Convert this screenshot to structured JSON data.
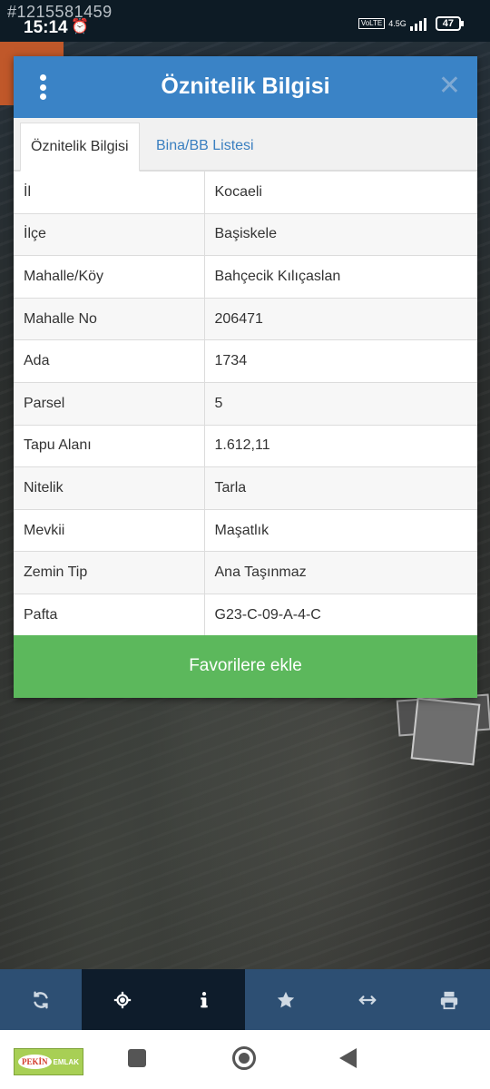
{
  "status_bar": {
    "watermark_id": "#1215581459",
    "time": "15:14",
    "network_badge": "VoLTE",
    "network_type": "4.5G",
    "battery": "47"
  },
  "dialog": {
    "title": "Öznitelik Bilgisi",
    "close_symbol": "✕",
    "tabs": [
      {
        "label": "Öznitelik Bilgisi",
        "active": true
      },
      {
        "label": "Bina/BB Listesi",
        "active": false
      }
    ],
    "rows": [
      {
        "key": "İl",
        "value": "Kocaeli"
      },
      {
        "key": "İlçe",
        "value": "Başiskele"
      },
      {
        "key": "Mahalle/Köy",
        "value": "Bahçecik Kılıçaslan"
      },
      {
        "key": "Mahalle No",
        "value": "206471"
      },
      {
        "key": "Ada",
        "value": "1734"
      },
      {
        "key": "Parsel",
        "value": "5"
      },
      {
        "key": "Tapu Alanı",
        "value": "1.612,11"
      },
      {
        "key": "Nitelik",
        "value": "Tarla"
      },
      {
        "key": "Mevkii",
        "value": "Maşatlık"
      },
      {
        "key": "Zemin Tip",
        "value": "Ana Taşınmaz"
      },
      {
        "key": "Pafta",
        "value": "G23-C-09-A-4-C"
      }
    ],
    "favorite_button": "Favorilere ekle"
  },
  "toolbar": {
    "icons": [
      "refresh-icon",
      "locate-icon",
      "info-icon",
      "star-icon",
      "measure-icon",
      "print-icon"
    ],
    "active_index": 1
  },
  "nav_bar": {
    "logo_name": "PEKİN",
    "logo_sub": "EMLAK"
  },
  "colors": {
    "header_blue": "#3a83c6",
    "favorite_green": "#5cb85c",
    "toolbar_blue": "#2d4f73",
    "tab_link_blue": "#3a7fc0"
  }
}
